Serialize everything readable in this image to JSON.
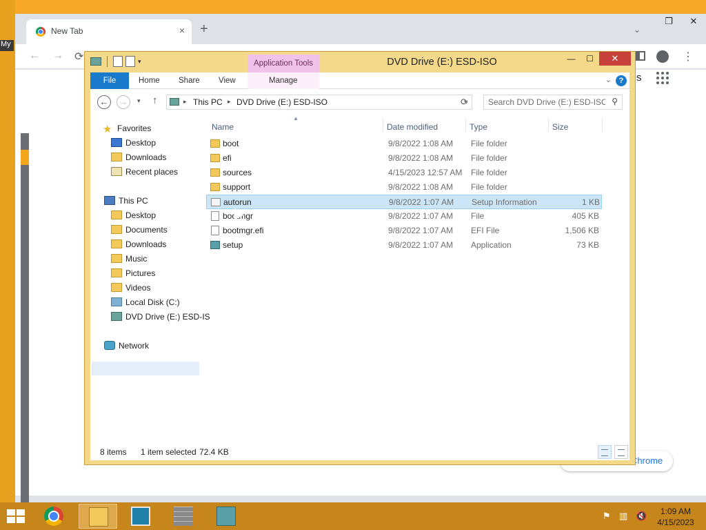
{
  "desktop": {
    "shortcut_label": "My"
  },
  "chrome": {
    "tab_title": "New Tab",
    "tab_close": "×",
    "new_tab": "+",
    "chevron": "⌄",
    "win_restore": "❐",
    "win_close": "✕",
    "back": "←",
    "forward": "→",
    "reload": "⟳",
    "kebab": "⋮",
    "pages_fragment": "ages",
    "customize_label": "Customize Chrome",
    "pencil": "✎"
  },
  "explorer": {
    "title": "DVD Drive (E:) ESD-ISO",
    "app_tools": "Application Tools",
    "win_min": "—",
    "win_max": "☐",
    "win_close": "✕",
    "ribbon": {
      "file": "File",
      "home": "Home",
      "share": "Share",
      "view": "View",
      "manage": "Manage",
      "expand": "⌄",
      "help": "?"
    },
    "address": {
      "back": "←",
      "forward": "→",
      "recent": "▾",
      "up": "↑",
      "crumbs": [
        "This PC",
        "DVD Drive (E:) ESD-ISO"
      ],
      "sep": "▸",
      "dropdown": "⌄",
      "refresh": "⟳"
    },
    "search": {
      "placeholder": "Search DVD Drive (E:) ESD-ISO",
      "icon": "⚲"
    },
    "nav": {
      "favorites": "Favorites",
      "fav_desktop": "Desktop",
      "fav_downloads": "Downloads",
      "fav_recent": "Recent places",
      "thispc": "This PC",
      "pc_desktop": "Desktop",
      "pc_documents": "Documents",
      "pc_downloads": "Downloads",
      "pc_music": "Music",
      "pc_pictures": "Pictures",
      "pc_videos": "Videos",
      "pc_localdisk": "Local Disk (C:)",
      "pc_dvd": "DVD Drive (E:) ESD-IS",
      "network": "Network",
      "star": "★"
    },
    "columns": {
      "name": "Name",
      "date": "Date modified",
      "type": "Type",
      "size": "Size",
      "sort": "▲"
    },
    "files": [
      {
        "name": "boot",
        "date": "9/8/2022 1:08 AM",
        "type": "File folder",
        "size": ""
      },
      {
        "name": "efi",
        "date": "9/8/2022 1:08 AM",
        "type": "File folder",
        "size": ""
      },
      {
        "name": "sources",
        "date": "4/15/2023 12:57 AM",
        "type": "File folder",
        "size": ""
      },
      {
        "name": "support",
        "date": "9/8/2022 1:08 AM",
        "type": "File folder",
        "size": ""
      },
      {
        "name": "autorun",
        "date": "9/8/2022 1:07 AM",
        "type": "Setup Information",
        "size": "1 KB"
      },
      {
        "name": "bootmgr",
        "date": "9/8/2022 1:07 AM",
        "type": "File",
        "size": "405 KB"
      },
      {
        "name": "bootmgr.efi",
        "date": "9/8/2022 1:07 AM",
        "type": "EFI File",
        "size": "1,506 KB"
      },
      {
        "name": "setup",
        "date": "9/8/2022 1:07 AM",
        "type": "Application",
        "size": "73 KB"
      }
    ],
    "status": {
      "items": "8 items",
      "selected": "1 item selected",
      "size": "72.4 KB"
    }
  },
  "taskbar": {
    "tray_flag": "⚑",
    "tray_net": "▥",
    "tray_vol": "🔇",
    "time": "1:09 AM",
    "date": "4/15/2023"
  }
}
